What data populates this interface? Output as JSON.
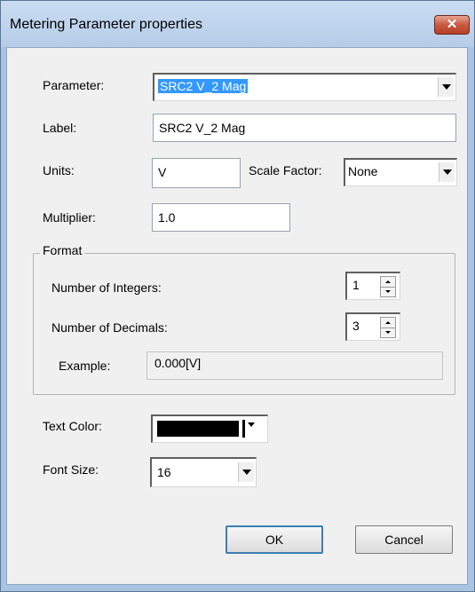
{
  "window": {
    "title": "Metering Parameter properties",
    "close_glyph": "✕"
  },
  "parameter": {
    "label": "Parameter:",
    "value": "SRC2      V_2 Mag"
  },
  "label_field": {
    "label": "Label:",
    "value": "SRC2      V_2 Mag"
  },
  "units": {
    "label": "Units:",
    "value": "V"
  },
  "scale_factor": {
    "label": "Scale Factor:",
    "value": "None"
  },
  "multiplier": {
    "label": "Multiplier:",
    "value": "1.0"
  },
  "format": {
    "group_title": "Format",
    "integers_label": "Number of Integers:",
    "integers_value": "1",
    "decimals_label": "Number of Decimals:",
    "decimals_value": "3",
    "example_label": "Example:",
    "example_value": "0.000[V]"
  },
  "text_color": {
    "label": "Text Color:",
    "value_color": "#000000"
  },
  "font_size": {
    "label": "Font Size:",
    "value": "16"
  },
  "buttons": {
    "ok": "OK",
    "cancel": "Cancel"
  }
}
